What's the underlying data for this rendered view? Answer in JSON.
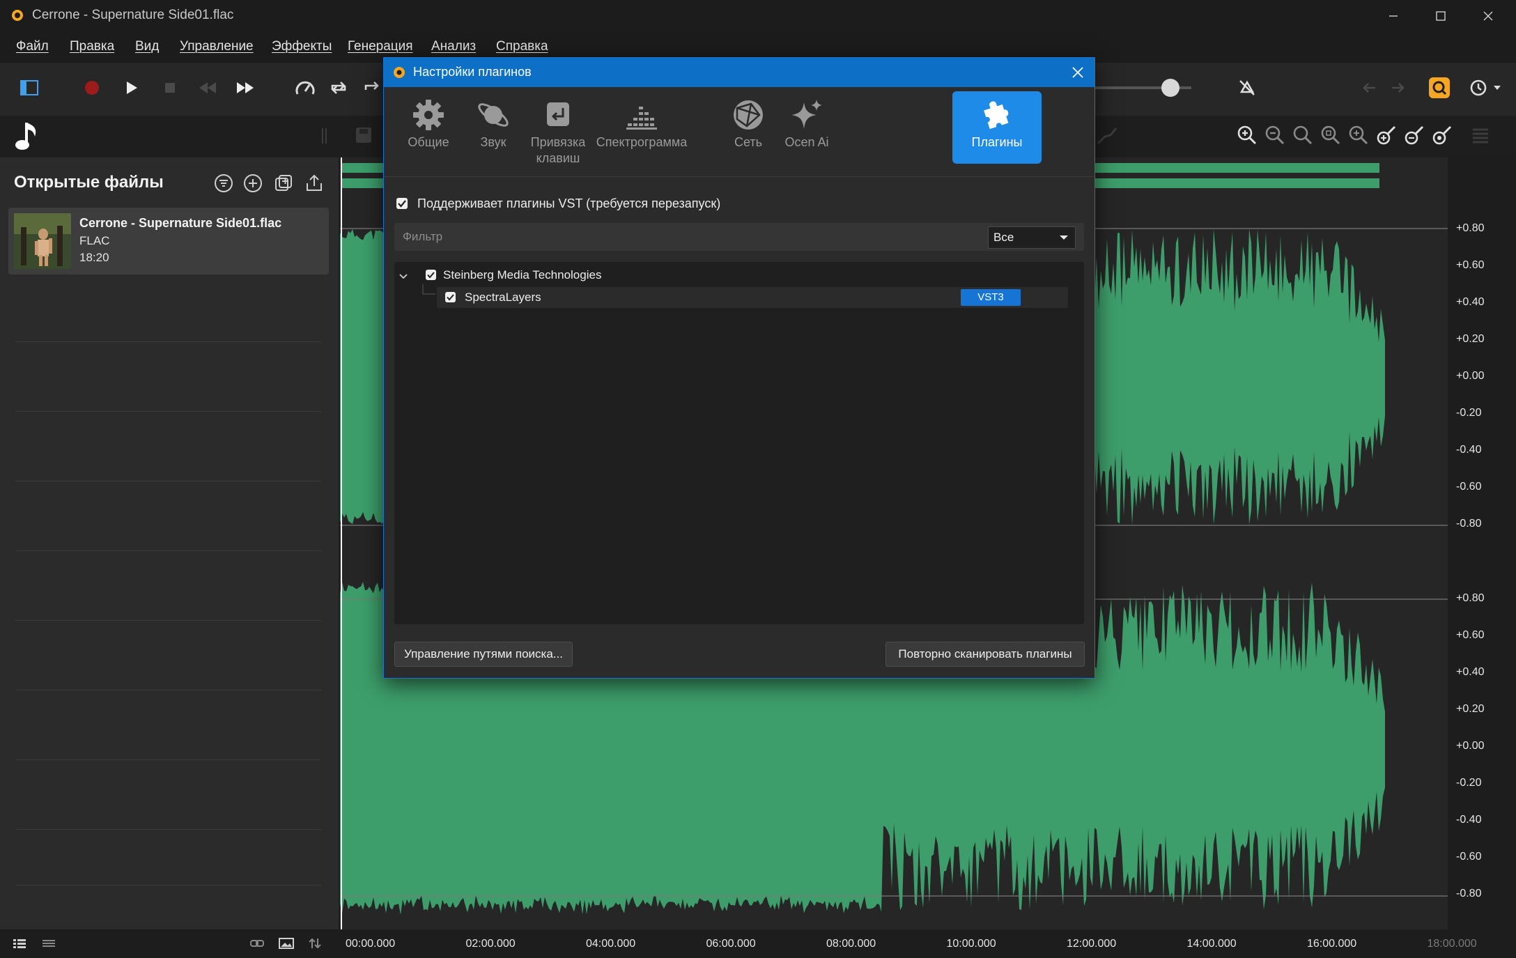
{
  "window": {
    "title": "Cerrone - Supernature Side01.flac"
  },
  "menu": {
    "items": [
      "Файл",
      "Правка",
      "Вид",
      "Управление",
      "Эффекты",
      "Генерация",
      "Анализ",
      "Справка"
    ]
  },
  "toolbar": {
    "icons": [
      "sidebar-toggle-icon",
      "record-icon",
      "play-icon",
      "stop-icon",
      "rewind-icon",
      "fast-forward-icon",
      "speed-icon",
      "loop-icon",
      "loop-selection-icon",
      "volume-slider",
      "auto-scroll-icon",
      "undo-icon",
      "redo-icon",
      "search-icon",
      "history-icon"
    ],
    "accent": "#f5a623"
  },
  "left_panel": {
    "heading": "Открытые файлы",
    "file": {
      "name": "Cerrone - Supernature Side01.flac",
      "format": "FLAC",
      "duration": "18:20"
    }
  },
  "waveform": {
    "color": "#3d9e6b",
    "amplitude_labels_top": [
      "+0.80",
      "+0.60",
      "+0.40",
      "+0.20",
      "+0.00",
      "-0.20",
      "-0.40",
      "-0.60",
      "-0.80"
    ],
    "amplitude_labels_bottom": [
      "+0.80",
      "+0.60",
      "+0.40",
      "+0.20",
      "+0.00",
      "-0.20",
      "-0.40",
      "-0.60",
      "-0.80"
    ],
    "timeline": [
      "00:00.000",
      "02:00.000",
      "04:00.000",
      "06:00.000",
      "08:00.000",
      "10:00.000",
      "12:00.000",
      "14:00.000",
      "16:00.000",
      "18:00.000"
    ]
  },
  "dialog": {
    "title": "Настройки плагинов",
    "tabs": [
      {
        "label": "Общие",
        "icon": "gear-icon"
      },
      {
        "label": "Звук",
        "icon": "planet-icon"
      },
      {
        "label": "Привязка клавиш",
        "icon": "keyboard-icon"
      },
      {
        "label": "Спектрограмма",
        "icon": "spectrogram-icon"
      },
      {
        "label": "Сеть",
        "icon": "network-icon"
      },
      {
        "label": "Ocen Ai",
        "icon": "sparkle-icon"
      },
      {
        "label": "Плагины",
        "icon": "puzzle-icon"
      }
    ],
    "active_tab": "Плагины",
    "vst_support": {
      "label": "Поддерживает плагины VST (требуется перезапуск)",
      "checked": true
    },
    "filter": {
      "placeholder": "Фильтр",
      "value": "",
      "select_value": "Все"
    },
    "tree": {
      "vendor": {
        "name": "Steinberg Media Technologies",
        "checked": true,
        "expanded": true
      },
      "plugin": {
        "name": "SpectraLayers",
        "checked": true,
        "badge": "VST3"
      }
    },
    "buttons": {
      "manage_paths": "Управление путями поиска...",
      "rescan": "Повторно сканировать плагины"
    },
    "accent": "#1e8be8"
  }
}
